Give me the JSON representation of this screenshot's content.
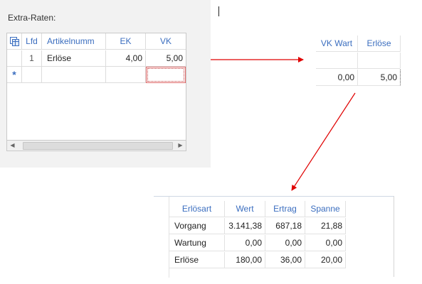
{
  "extra_raten": {
    "title": "Extra-Raten:",
    "columns": {
      "lfd": "Lfd",
      "artikel": "Artikelnumm",
      "ek": "EK",
      "vk": "VK"
    },
    "row1": {
      "lfd": "1",
      "artikel": "Erlöse",
      "ek": "4,00",
      "vk": "5,00"
    },
    "new_row_marker": "*",
    "scroll_left": "◀",
    "scroll_right": "▶"
  },
  "vk_grid": {
    "columns": {
      "vk_wert": "VK Wart",
      "erloese": "Erlöse"
    },
    "row1": {
      "vk_wert": "0,00",
      "erloese": "5,00"
    }
  },
  "summary_grid": {
    "columns": {
      "art": "Erlösart",
      "wert": "Wert",
      "ertrag": "Ertrag",
      "spanne": "Spanne"
    },
    "rows": [
      {
        "art": "Vorgang",
        "wert": "3.141,38",
        "ertrag": "687,18",
        "spanne": "21,88"
      },
      {
        "art": "Wartung",
        "wert": "0,00",
        "ertrag": "0,00",
        "spanne": "0,00"
      },
      {
        "art": "Erlöse",
        "wert": "180,00",
        "ertrag": "36,00",
        "spanne": "20,00"
      }
    ]
  },
  "colors": {
    "header_text": "#3b6ebf",
    "arrow": "#e00000"
  }
}
